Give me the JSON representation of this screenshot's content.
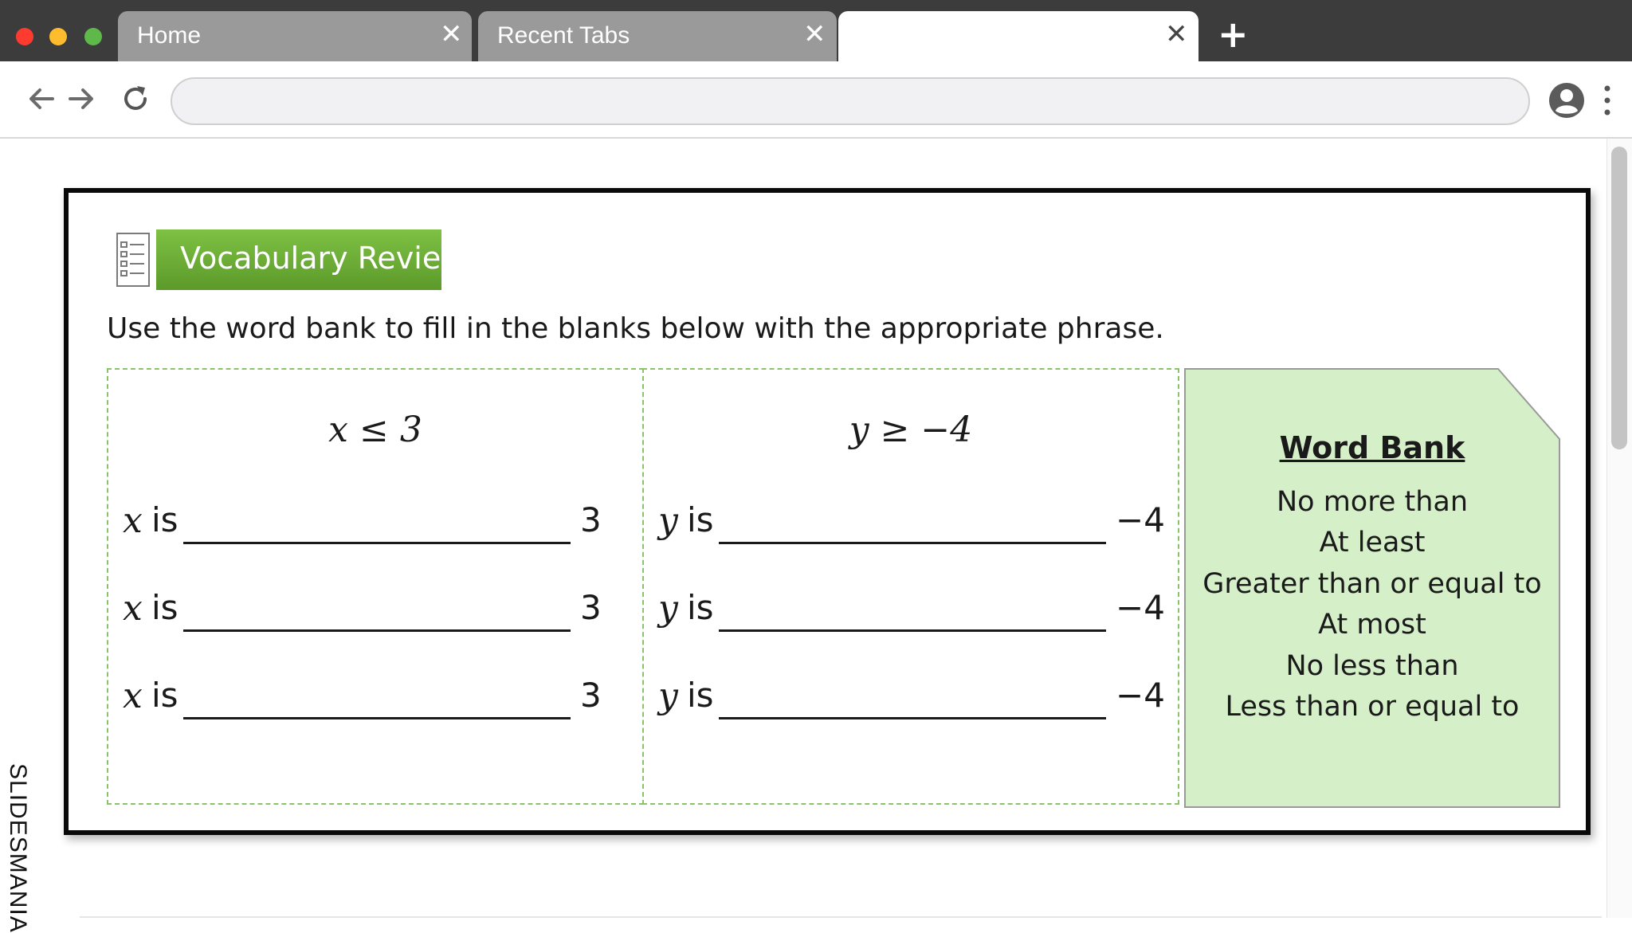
{
  "browser": {
    "traffic_lights": {
      "close": "#ff3b30",
      "minimize": "#ffbd2e",
      "zoom": "#5fb84a"
    },
    "tabs": [
      {
        "title": "Home",
        "close": "✕"
      },
      {
        "title": "Recent Tabs",
        "close": "✕"
      },
      {
        "title": "",
        "close": "✕"
      }
    ],
    "new_tab_symbol": "+",
    "address_value": ""
  },
  "slide": {
    "section_title": "Vocabulary Review",
    "instruction": "Use the word bank to fill in the blanks below with the appropriate phrase.",
    "panels": [
      {
        "heading": "x ≤ 3",
        "variable": "x",
        "verb": "is",
        "value": "3",
        "rows": 3
      },
      {
        "heading": "y ≥ −4",
        "variable": "y",
        "verb": "is",
        "value": "−4",
        "rows": 3
      }
    ],
    "word_bank": {
      "title": "Word Bank",
      "items": [
        "No more than",
        "At least",
        "Greater than or equal to",
        "At most",
        "No less than",
        "Less than or equal to"
      ]
    },
    "colors": {
      "banner": "#6aaa34",
      "word_bank_bg": "#d5f0c8",
      "panel_border": "#8bc36b"
    }
  },
  "side_label": "SLIDESMANIA"
}
